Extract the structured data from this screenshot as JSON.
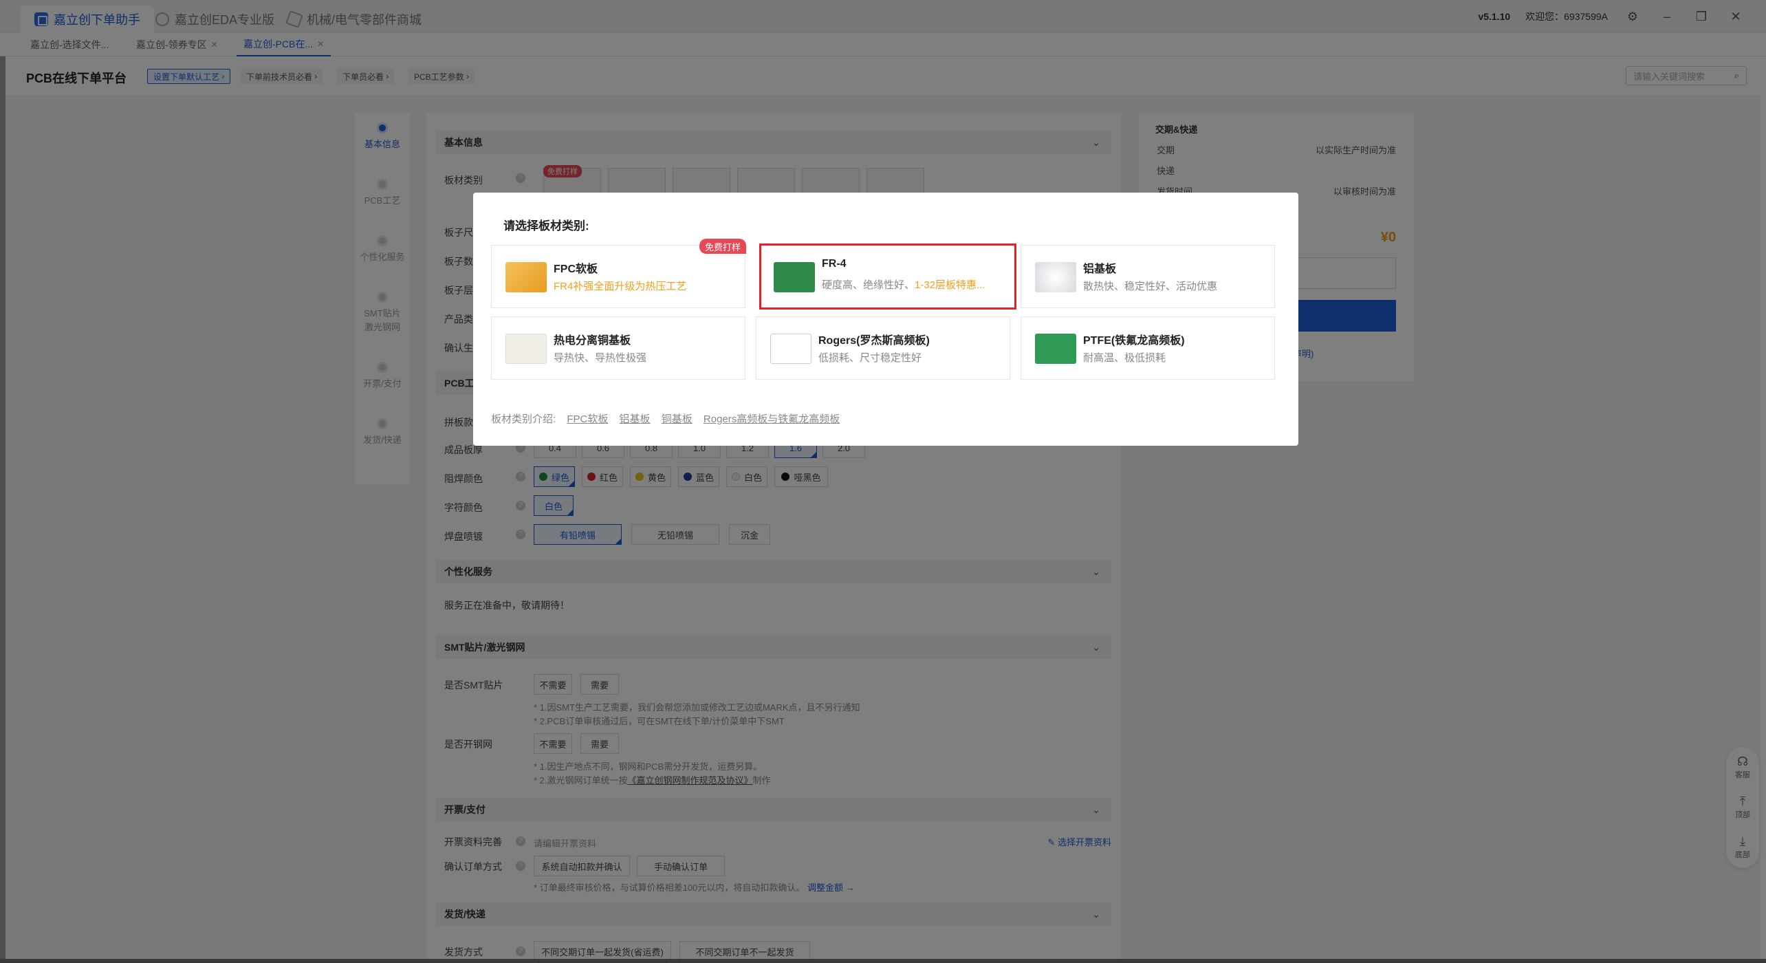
{
  "app_tabs": [
    {
      "label": "嘉立创下单助手",
      "active": true
    },
    {
      "label": "嘉立创EDA专业版",
      "active": false
    },
    {
      "label": "机械/电气零部件商城",
      "active": false
    }
  ],
  "app_right": {
    "version": "v5.1.10",
    "welcome": "欢迎您：6937599A"
  },
  "page_tabs": [
    {
      "label": "嘉立创-选择文件..."
    },
    {
      "label": "嘉立创-领券专区"
    },
    {
      "label": "嘉立创-PCB在..."
    }
  ],
  "platform": {
    "title": "PCB在线下单平台",
    "links": [
      "设置下单默认工艺",
      "下单前技术员必看",
      "下单员必看",
      "PCB工艺参数"
    ],
    "search_placeholder": "请输入关键词搜索"
  },
  "steps": [
    "基本信息",
    "PCB工艺",
    "个性化服务",
    "SMT贴片\n激光钢网",
    "开票/支付",
    "发货/快递"
  ],
  "form": {
    "sec_basic": "基本信息",
    "label_material": "板材类别",
    "free_tag": "免费打样",
    "labels_hidden": [
      "板子尺",
      "板子数",
      "板子层",
      "产品类",
      "确认生"
    ],
    "sec_pcb": "PCB工",
    "label_panel": "拼板款",
    "label_thickness": "成品板厚",
    "thickness": [
      "0.4",
      "0.6",
      "0.8",
      "1.0",
      "1.2",
      "1.6",
      "2.0"
    ],
    "label_mask": "阻焊颜色",
    "mask_colors": [
      {
        "label": "绿色",
        "color": "#1a8f3a"
      },
      {
        "label": "红色",
        "color": "#d9232a"
      },
      {
        "label": "黄色",
        "color": "#e5c21a"
      },
      {
        "label": "蓝色",
        "color": "#1d3f9e"
      },
      {
        "label": "白色",
        "color": "#eeeeee"
      },
      {
        "label": "哑黑色",
        "color": "#111111"
      }
    ],
    "label_silk": "字符颜色",
    "silk_color": "白色",
    "label_pad": "焊盘喷镀",
    "pad_options": [
      "有铅喷锡",
      "无铅喷锡",
      "沉金"
    ],
    "sec_custom": "个性化服务",
    "custom_note": "服务正在准备中，敬请期待！",
    "sec_smt": "SMT贴片/激光钢网",
    "label_smt": "是否SMT贴片",
    "no": "不需要",
    "yes": "需要",
    "smt_note1": "* 1.因SMT生产工艺需要，我们会帮您添加或修改工艺边或MARK点，且不另行通知",
    "smt_note2": "* 2.PCB订单审核通过后，可在SMT在线下单/计价菜单中下SMT",
    "label_stencil": "是否开钢网",
    "stencil_note1": "* 1.因生产地点不同，钢网和PCB需分开发货，运费另算。",
    "stencil_note2_pre": "* 2.激光钢网订单统一按",
    "stencil_note2_link": "《嘉立创钢网制作规范及协议》",
    "stencil_note2_post": "制作",
    "sec_invoice": "开票/支付",
    "label_invoice": "开票资料完善",
    "invoice_placeholder": "请编辑开票资料",
    "invoice_link": "选择开票资料",
    "label_confirm": "确认订单方式",
    "confirm_auto": "系统自动扣款并确认",
    "confirm_manual": "手动确认订单",
    "confirm_note": "* 订单最终审核价格，与试算价格相差100元以内，将自动扣款确认。",
    "confirm_link": "调整金额 →",
    "sec_ship": "发货/快递",
    "label_ship": "发货方式",
    "ship_opt1": "不同交期订单一起发货(省运费)",
    "ship_opt2": "不同交期订单不一起发货"
  },
  "side": {
    "title": "交期&快递",
    "row1_label": "交期",
    "row1_value": "以实际生产时间为准",
    "row2_label": "快递",
    "row3_label": "发货时间",
    "row3_value": "以审核时间为准",
    "price": "¥0",
    "disclaimer": "声明)"
  },
  "float_tools": [
    "客服",
    "顶部",
    "底部"
  ],
  "modal": {
    "title": "请选择板材类别:",
    "cards": [
      {
        "title": "FPC软板",
        "subtitle": "FR4补强全面升级为热压工艺",
        "badge": "免费打样"
      },
      {
        "title": "FR-4",
        "subtitle_gray": "硬度高、绝缘性好、",
        "subtitle_orange": "1-32层板特惠..."
      },
      {
        "title": "铝基板",
        "subtitle": "散热快、稳定性好、活动优惠"
      },
      {
        "title": "热电分离铜基板",
        "subtitle": "导热快、导热性极强"
      },
      {
        "title": "Rogers(罗杰斯高频板)",
        "subtitle": "低损耗、尺寸稳定性好"
      },
      {
        "title": "PTFE(铁氟龙高频板)",
        "subtitle": "耐高温、极低损耗"
      }
    ],
    "intro_label": "板材类别介绍:",
    "intro_links": [
      "FPC软板",
      "铝基板",
      "铜基板",
      "Rogers高频板与铁氟龙高频板"
    ]
  }
}
